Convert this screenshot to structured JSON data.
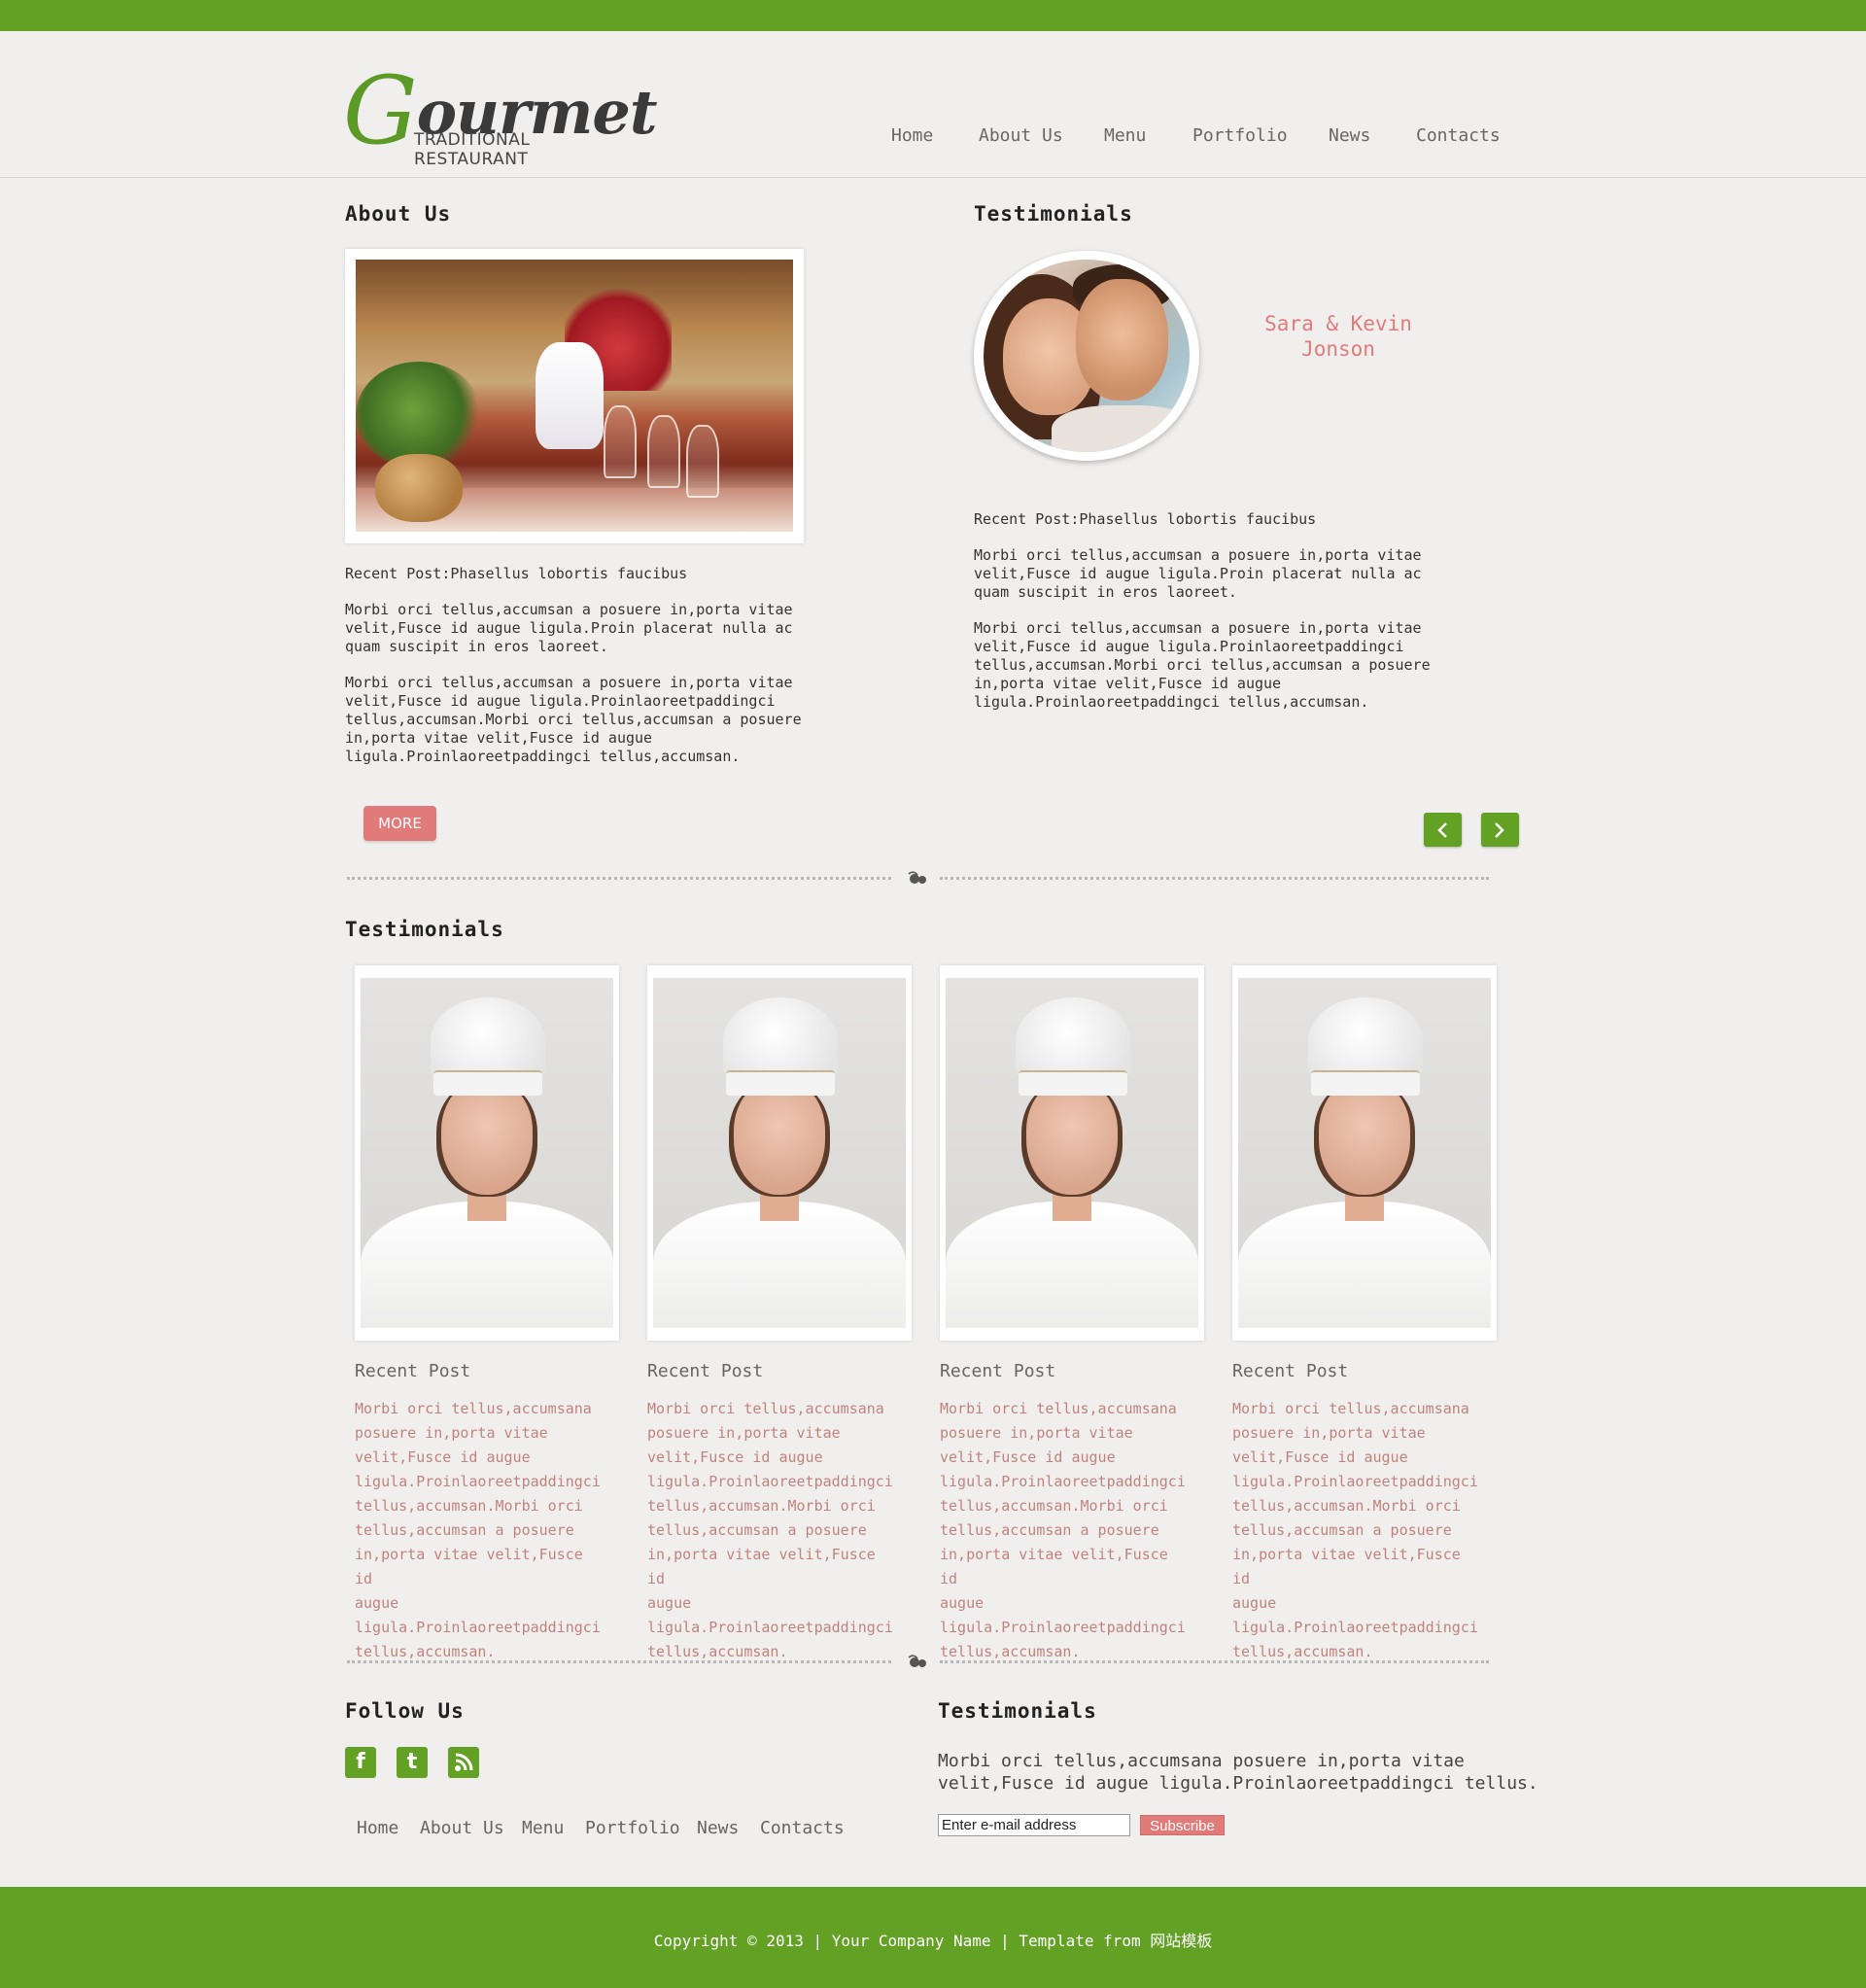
{
  "brand": {
    "logo_text": "Gourmet",
    "tagline": "TRADITIONAL RESTAURANT",
    "green": "#62a124",
    "pink": "#e07b79"
  },
  "nav": {
    "items": [
      "Home",
      "About Us",
      "Menu",
      "Portfolio",
      "News",
      "Contacts"
    ]
  },
  "about": {
    "title": "About Us",
    "recent_post": "Recent Post:Phasellus lobortis faucibus",
    "para1": "Morbi orci tellus,accumsan a posuere in,porta vitae\nvelit,Fusce id augue ligula.Proin placerat nulla ac\nquam suscipit in eros laoreet.",
    "para2": "Morbi orci tellus,accumsan a posuere in,porta vitae\nvelit,Fusce id augue ligula.Proinlaoreetpaddingci\ntellus,accumsan.Morbi orci tellus,accumsan a posuere\nin,porta vitae velit,Fusce id augue\nligula.Proinlaoreetpaddingci tellus,accumsan.",
    "more_button": "MORE"
  },
  "testimonial_top": {
    "title": "Testimonials",
    "name_line1": "Sara & Kevin",
    "name_line2": "Jonson",
    "recent_post": "Recent Post:Phasellus lobortis faucibus",
    "para1": "Morbi orci tellus,accumsan a posuere in,porta vitae\nvelit,Fusce id augue ligula.Proin placerat nulla ac\nquam suscipit in eros laoreet.",
    "para2": "Morbi orci tellus,accumsan a posuere in,porta vitae\nvelit,Fusce id augue ligula.Proinlaoreetpaddingci\ntellus,accumsan.Morbi orci tellus,accumsan a posuere\nin,porta vitae velit,Fusce id augue\nligula.Proinlaoreetpaddingci tellus,accumsan.",
    "prev_icon": "chevron-left-icon",
    "next_icon": "chevron-right-icon"
  },
  "testimonials_grid": {
    "title": "Testimonials",
    "cards": [
      {
        "title": "Recent Post",
        "text": "Morbi orci tellus,accumsana\nposuere in,porta vitae\nvelit,Fusce id augue\nligula.Proinlaoreetpaddingci\ntellus,accumsan.Morbi orci\ntellus,accumsan a posuere\nin,porta vitae velit,Fusce id\naugue\nligula.Proinlaoreetpaddingci\ntellus,accumsan."
      },
      {
        "title": "Recent Post",
        "text": "Morbi orci tellus,accumsana\nposuere in,porta vitae\nvelit,Fusce id augue\nligula.Proinlaoreetpaddingci\ntellus,accumsan.Morbi orci\ntellus,accumsan a posuere\nin,porta vitae velit,Fusce id\naugue\nligula.Proinlaoreetpaddingci\ntellus,accumsan."
      },
      {
        "title": "Recent Post",
        "text": "Morbi orci tellus,accumsana\nposuere in,porta vitae\nvelit,Fusce id augue\nligula.Proinlaoreetpaddingci\ntellus,accumsan.Morbi orci\ntellus,accumsan a posuere\nin,porta vitae velit,Fusce id\naugue\nligula.Proinlaoreetpaddingci\ntellus,accumsan."
      },
      {
        "title": "Recent Post",
        "text": "Morbi orci tellus,accumsana\nposuere in,porta vitae\nvelit,Fusce id augue\nligula.Proinlaoreetpaddingci\ntellus,accumsan.Morbi orci\ntellus,accumsan a posuere\nin,porta vitae velit,Fusce id\naugue\nligula.Proinlaoreetpaddingci\ntellus,accumsan."
      }
    ]
  },
  "follow": {
    "title": "Follow Us",
    "icons": [
      "facebook-icon",
      "twitter-icon",
      "rss-icon"
    ],
    "icon_glyphs": [
      "f",
      "t",
      "◔"
    ],
    "nav": [
      "Home",
      "About Us",
      "Menu",
      "Portfolio",
      "News",
      "Contacts"
    ]
  },
  "newsletter": {
    "title": "Testimonials",
    "text": "Morbi orci tellus,accumsana posuere in,porta vitae\nvelit,Fusce id augue ligula.Proinlaoreetpaddingci tellus.",
    "placeholder": "Enter e-mail address",
    "subscribe": "Subscribe"
  },
  "footer": {
    "copyright": "Copyright © 2013 | Your Company Name | Template from 网站模板"
  }
}
